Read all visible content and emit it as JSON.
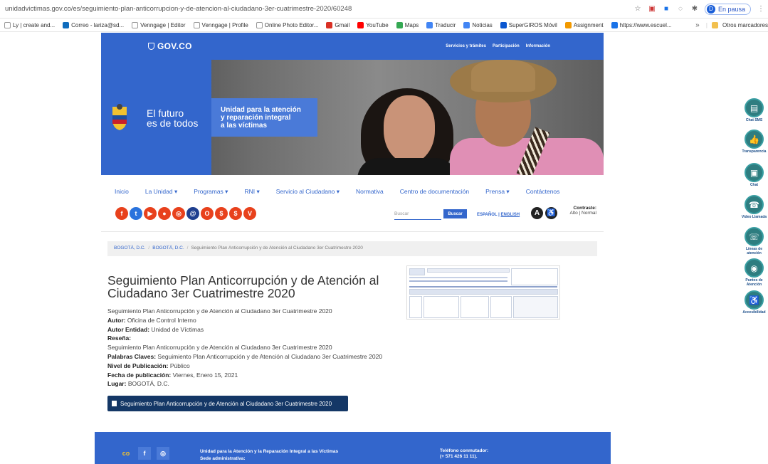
{
  "browser": {
    "url": "unidadvictimas.gov.co/es/seguimiento-plan-anticorrupcion-y-de-atencion-al-ciudadano-3er-cuatrimestre-2020/60248",
    "profile_letter": "D",
    "profile_status": "En pausa",
    "bookmarks": [
      {
        "label": "Ly | create and...",
        "color": "#ffffff"
      },
      {
        "label": "Correo - lariza@sd...",
        "color": "#0f6cbd"
      },
      {
        "label": "Venngage | Editor",
        "color": "#ffffff"
      },
      {
        "label": "Venngage | Profile",
        "color": "#ffffff"
      },
      {
        "label": "Online Photo Editor...",
        "color": "#ffffff"
      },
      {
        "label": "Gmail",
        "color": "#d93025"
      },
      {
        "label": "YouTube",
        "color": "#ff0000"
      },
      {
        "label": "Maps",
        "color": "#34a853"
      },
      {
        "label": "Traducir",
        "color": "#4285f4"
      },
      {
        "label": "Noticias",
        "color": "#4285f4"
      },
      {
        "label": "SuperGIROS Móvil",
        "color": "#0b57d0"
      },
      {
        "label": "Assignment",
        "color": "#f29900"
      },
      {
        "label": "https://www.escuel...",
        "color": "#1a73e8"
      }
    ],
    "other_bookmarks": "Otros marcadores"
  },
  "site": {
    "gov_logo": "GOV.CO",
    "top_nav": [
      "Servicios y trámites",
      "Participación",
      "Información"
    ],
    "banner_slogan_line1": "El futuro",
    "banner_slogan_line2": "es de todos",
    "banner_unit_line1": "Unidad para la atención",
    "banner_unit_line2": "y reparación integral",
    "banner_unit_line3": "a las víctimas",
    "menu": [
      "Inicio",
      "La Unidad ▾",
      "Programas ▾",
      "RNI ▾",
      "Servicio al Ciudadano ▾",
      "Normativa",
      "Centro de documentación",
      "Prensa ▾",
      "Contáctenos"
    ],
    "social": [
      {
        "name": "facebook-icon",
        "glyph": "f",
        "color": "#e8411c"
      },
      {
        "name": "twitter-icon",
        "glyph": "t",
        "color": "#2a73dd"
      },
      {
        "name": "youtube-icon",
        "glyph": "▶",
        "color": "#e8411c"
      },
      {
        "name": "flickr-icon",
        "glyph": "●",
        "color": "#e8411c"
      },
      {
        "name": "instagram-icon",
        "glyph": "◎",
        "color": "#e8411c"
      },
      {
        "name": "email-icon",
        "glyph": "@",
        "color": "#1f3f8f"
      },
      {
        "name": "o-icon",
        "glyph": "O",
        "color": "#e8411c"
      },
      {
        "name": "s-icon",
        "glyph": "$",
        "color": "#e8411c"
      },
      {
        "name": "s2-icon",
        "glyph": "$",
        "color": "#e8411c"
      },
      {
        "name": "v-icon",
        "glyph": "V",
        "color": "#e8411c"
      }
    ],
    "search_placeholder": "Buscar",
    "search_button": "Buscar",
    "lang_es": "ESPAÑOL",
    "lang_en": "ENGLISH",
    "contrast_title": "Contraste:",
    "contrast_high": "Alto",
    "contrast_normal": "Normal",
    "breadcrumb": [
      "BOGOTÁ, D.C.",
      "BOGOTÁ, D.C.",
      "Seguimiento Plan Anticorrupción y de Atención al Ciudadano 3er Cuatrimestre 2020"
    ]
  },
  "doc": {
    "title": "Seguimiento Plan Anticorrupción y de Atención al Ciudadano 3er Cuatrimestre 2020",
    "subtitle": "Seguimiento Plan Anticorrupción y de Atención al Ciudadano 3er Cuatrimestre 2020",
    "autor_label": "Autor:",
    "autor": "Oficina de Control Interno",
    "autor_entidad_label": "Autor Entidad:",
    "autor_entidad": "Unidad de Víctimas",
    "resena_label": "Reseña:",
    "resena": "Seguimiento Plan Anticorrupción y de Atención al Ciudadano 3er Cuatrimestre 2020",
    "palabras_label": "Palabras Claves:",
    "palabras": "Seguimiento Plan Anticorrupción y de Atención al Ciudadano 3er Cuatrimestre 2020",
    "nivel_label": "Nivel de Publicación:",
    "nivel": "Público",
    "fecha_label": "Fecha de publicación:",
    "fecha": "Viernes, Enero 15, 2021",
    "lugar_label": "Lugar:",
    "lugar": "BOGOTÁ, D.C.",
    "download_label": "Seguimiento Plan Anticorrupción y de Atención al Ciudadano 3er Cuatrimestre 2020"
  },
  "footer": {
    "line1": "Unidad para la Atención y la Reparación Integral a las Víctimas",
    "line2": "Sede administrativa:",
    "phone_label": "Teléfono conmutador:",
    "phone": "(+ 571 426 11 11)."
  },
  "side_widgets": [
    "Chat SMS",
    "Transparencia",
    "Chat",
    "Video Llamada",
    "Líneas de atención",
    "Puntos de Atención",
    "Accesibilidad"
  ]
}
